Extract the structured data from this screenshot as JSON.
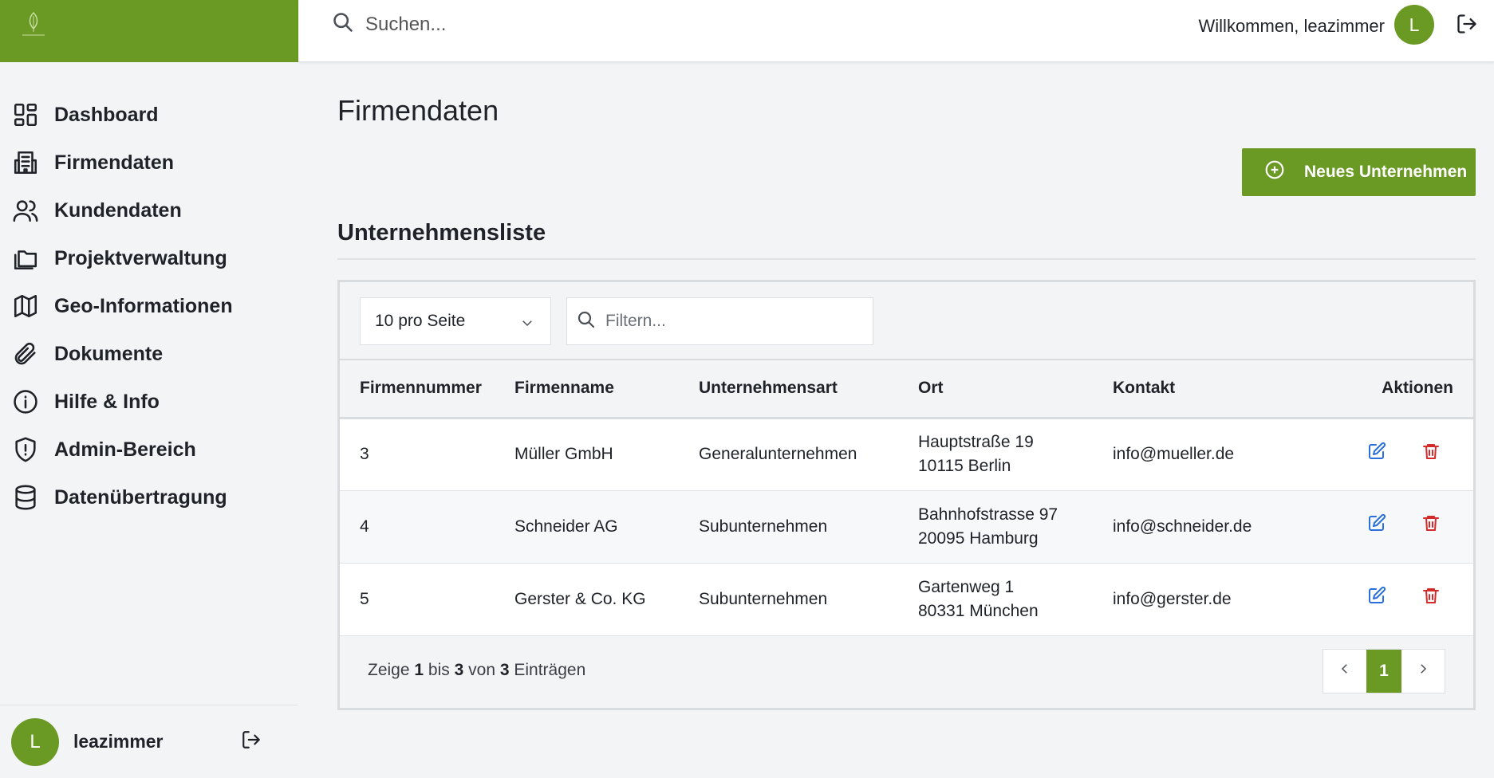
{
  "colors": {
    "accent": "#6a9a23",
    "edit": "#2a6fdb",
    "delete": "#d42a2a"
  },
  "sidebar": {
    "items": [
      {
        "label": "Dashboard",
        "icon": "dashboard-grid-icon"
      },
      {
        "label": "Firmendaten",
        "icon": "building-icon"
      },
      {
        "label": "Kundendaten",
        "icon": "users-icon"
      },
      {
        "label": "Projektverwaltung",
        "icon": "folders-icon"
      },
      {
        "label": "Geo-Informationen",
        "icon": "map-icon"
      },
      {
        "label": "Dokumente",
        "icon": "paperclip-icon"
      },
      {
        "label": "Hilfe & Info",
        "icon": "info-icon"
      },
      {
        "label": "Admin-Bereich",
        "icon": "shield-alert-icon"
      },
      {
        "label": "Datenübertragung",
        "icon": "database-icon"
      }
    ],
    "user": {
      "initial": "L",
      "name": "leazimmer"
    }
  },
  "header": {
    "search_placeholder": "Suchen...",
    "welcome": "Willkommen, leazimmer",
    "avatar_initial": "L"
  },
  "main": {
    "title": "Firmendaten",
    "new_button": "Neues Unternehmen",
    "section_title": "Unternehmensliste",
    "page_size": "10 pro Seite",
    "filter_placeholder": "Filtern...",
    "columns": [
      "Firmennummer",
      "Firmenname",
      "Unternehmensart",
      "Ort",
      "Kontakt",
      "Aktionen"
    ],
    "rows": [
      {
        "nummer": "3",
        "name": "Müller GmbH",
        "art": "Generalunternehmen",
        "strasse": "Hauptstraße 19",
        "plz_ort": "10115 Berlin",
        "kontakt": "info@mueller.de"
      },
      {
        "nummer": "4",
        "name": "Schneider AG",
        "art": "Subunternehmen",
        "strasse": "Bahnhofstrasse 97",
        "plz_ort": "20095 Hamburg",
        "kontakt": "info@schneider.de"
      },
      {
        "nummer": "5",
        "name": "Gerster & Co. KG",
        "art": "Subunternehmen",
        "strasse": "Gartenweg 1",
        "plz_ort": "80331 München",
        "kontakt": "info@gerster.de"
      }
    ],
    "pagination": {
      "prefix": "Zeige",
      "from": "1",
      "to_word": "bis",
      "to": "3",
      "of_word": "von",
      "total": "3",
      "suffix": "Einträgen",
      "current_page": "1"
    }
  }
}
